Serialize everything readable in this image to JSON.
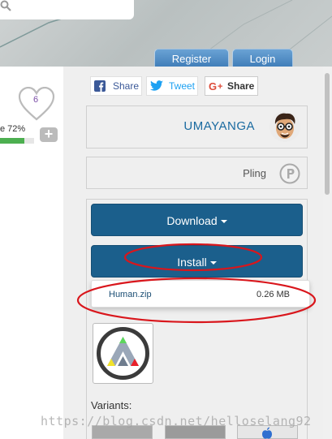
{
  "header": {
    "search": {
      "placeholder": "",
      "value": "",
      "icon": "search-icon"
    },
    "register_label": "Register",
    "login_label": "Login"
  },
  "product": {
    "likes": "6",
    "score_text": "e 72%",
    "score_fraction": 0.72
  },
  "share": {
    "facebook_label": "Share",
    "twitter_label": "Tweet",
    "google_label": "Share"
  },
  "creator": {
    "username": "UMAYANGA"
  },
  "pling": {
    "label": "Pling"
  },
  "actions": {
    "download_label": "Download",
    "install_label": "Install"
  },
  "files": [
    {
      "name": "Human.zip",
      "size": "0.26 MB"
    }
  ],
  "variants_label": "Variants:",
  "watermark": "https://blog.csdn.net/helloselang92",
  "colors": {
    "accent": "#1b5f8c",
    "username": "#1a6aa0",
    "score": "#4caf50",
    "annotation": "#d9161c"
  }
}
